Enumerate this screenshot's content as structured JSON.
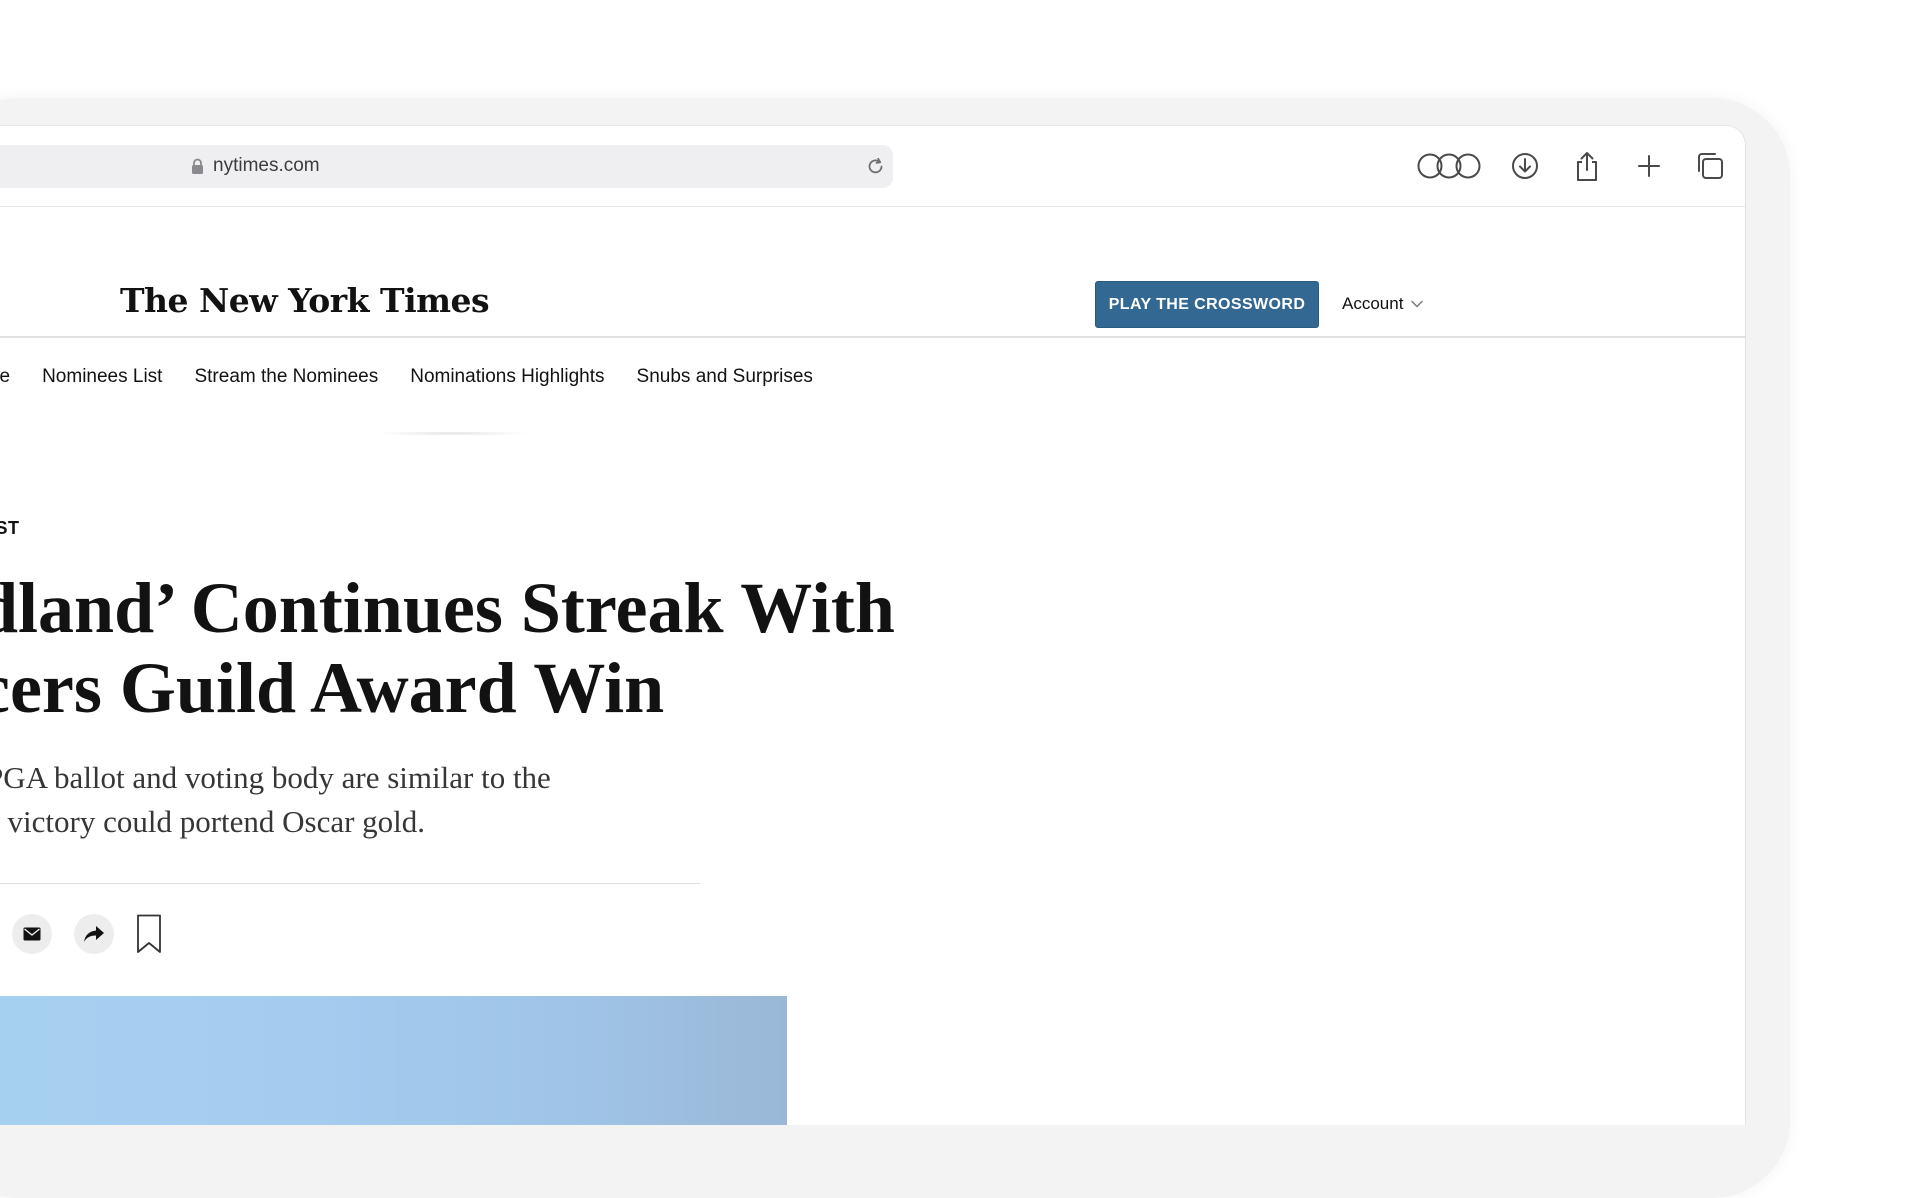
{
  "browser": {
    "url": "nytimes.com",
    "icons": [
      "lock-icon",
      "reload-icon",
      "tab-groups-icon",
      "download-icon",
      "share-icon",
      "new-tab-icon",
      "tab-overview-icon"
    ]
  },
  "header": {
    "logo": "The New York Times",
    "crossword_button": "PLAY THE CROSSWORD",
    "account_label": "Account"
  },
  "nav": {
    "items": [
      "ce",
      "Nominees List",
      "Stream the Nominees",
      "Nominations Highlights",
      "Snubs and Surprises"
    ]
  },
  "article": {
    "kicker": "IST",
    "headline_line1": "dland’ Continues Streak With",
    "headline_line2": "cers Guild Award Win",
    "summary_line1": "PGA ballot and voting body are similar to the",
    "summary_line2": "e victory could portend Oscar gold."
  },
  "colors": {
    "crossword_button": "#326891",
    "address_bar": "#efeff1",
    "hero_image": "#a6d0f0"
  }
}
